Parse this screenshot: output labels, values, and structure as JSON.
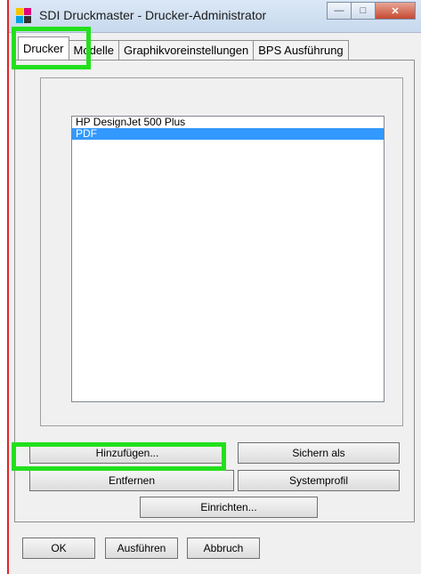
{
  "window": {
    "title": "SDI Druckmaster - Drucker-Administrator"
  },
  "tabs": [
    {
      "label": "Drucker"
    },
    {
      "label": "Modelle"
    },
    {
      "label": "Graphikvoreinstellungen"
    },
    {
      "label": "BPS Ausführung"
    }
  ],
  "printers": {
    "items": [
      {
        "label": "HP DesignJet 500 Plus"
      },
      {
        "label": "PDF",
        "selected": true
      }
    ]
  },
  "buttons": {
    "add": "Hinzufügen...",
    "save_as": "Sichern als",
    "remove": "Entfernen",
    "system_profile": "Systemprofil",
    "setup": "Einrichten...",
    "ok": "OK",
    "run": "Ausführen",
    "cancel": "Abbruch"
  },
  "colors": {
    "highlight": "#22e01c",
    "selection": "#3399ff"
  }
}
